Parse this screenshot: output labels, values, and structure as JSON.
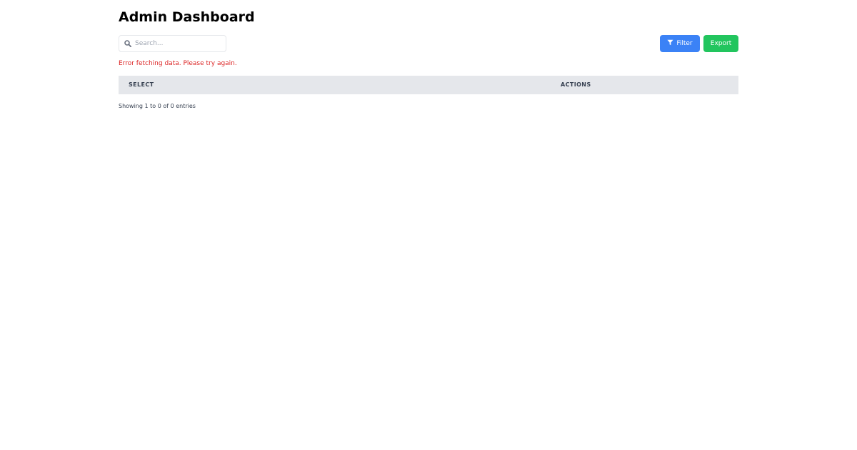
{
  "header": {
    "title": "Admin Dashboard"
  },
  "toolbar": {
    "search": {
      "placeholder": "Search...",
      "value": ""
    },
    "filter_label": "Filter",
    "export_label": "Export"
  },
  "status": {
    "error": "Error fetching data. Please try again."
  },
  "table": {
    "columns": [
      "SELECT",
      "ACTIONS"
    ],
    "rows": []
  },
  "pagination": {
    "info": "Showing 1 to 0 of 0 entries"
  },
  "icons": {
    "search": "search-icon",
    "filter": "filter-icon"
  },
  "colors": {
    "filter_button": "#3b82f6",
    "export_button": "#22c55e",
    "error_text": "#dc2626",
    "table_header_bg": "#e5e7eb"
  }
}
